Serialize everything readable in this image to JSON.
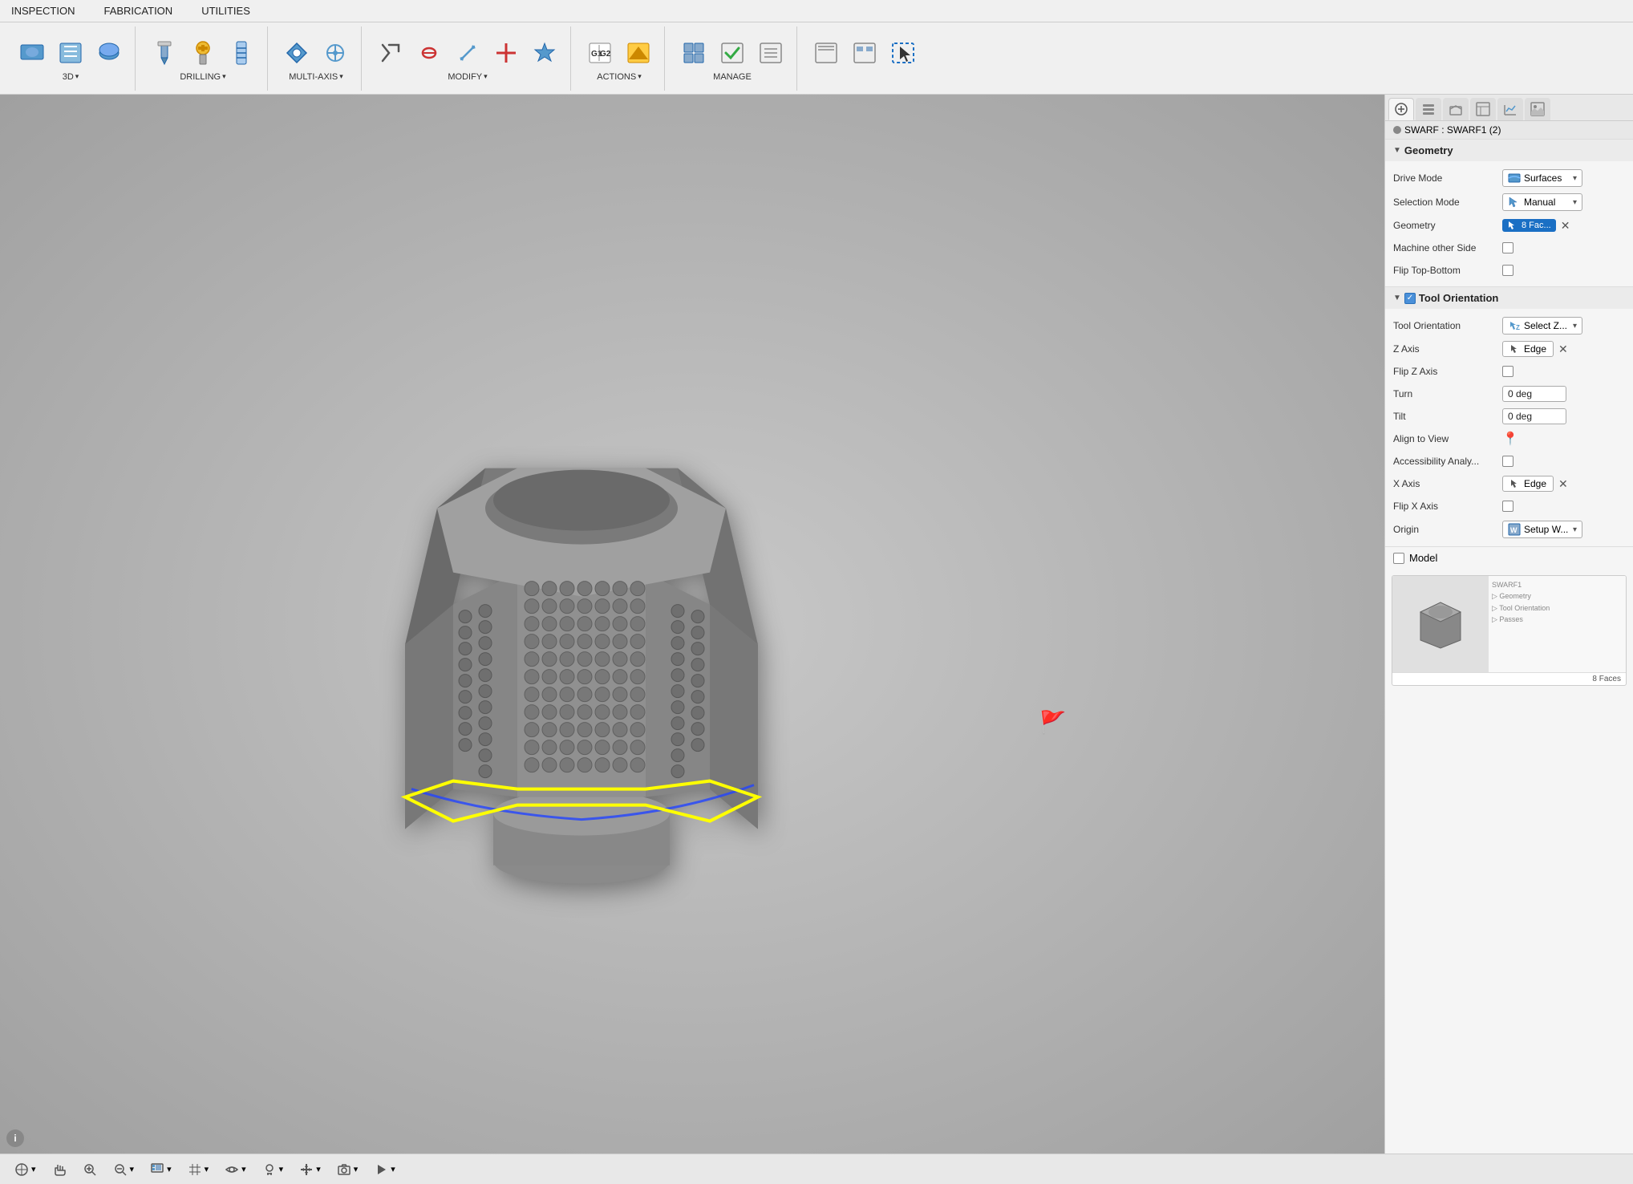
{
  "menu": {
    "items": [
      "INSPECTION",
      "FABRICATION",
      "UTILITIES"
    ]
  },
  "toolbar": {
    "groups": [
      {
        "label": "3D",
        "hasArrow": true,
        "icons": [
          "3d-turning-icon",
          "3d-milling-icon",
          "3d-pocket-icon"
        ]
      },
      {
        "label": "DRILLING",
        "hasArrow": true,
        "icons": [
          "drill-icon",
          "drill2-icon",
          "drill3-icon"
        ]
      },
      {
        "label": "MULTI-AXIS",
        "hasArrow": true,
        "icons": [
          "multiaxis-icon",
          "multiaxis2-icon"
        ]
      },
      {
        "label": "MODIFY",
        "hasArrow": true,
        "icons": [
          "modify-scissors-icon",
          "modify-chain-icon",
          "modify-arrow-icon",
          "modify-cross-icon",
          "modify-star-icon"
        ]
      },
      {
        "label": "ACTIONS",
        "hasArrow": true,
        "icons": [
          "g1g2-icon",
          "actions2-icon"
        ]
      },
      {
        "label": "MANAGE",
        "icons": [
          "manage1-icon",
          "manage2-icon",
          "manage3-icon"
        ]
      },
      {
        "label": "",
        "icons": [
          "nav1-icon",
          "nav2-icon",
          "select-icon"
        ]
      }
    ]
  },
  "panel": {
    "swarf_title": "SWARF : SWARF1 (2)",
    "tabs": [
      "wrench-icon",
      "layers-icon",
      "box-icon",
      "table-icon",
      "chart-icon",
      "image-icon"
    ],
    "geometry_section": {
      "label": "Geometry",
      "expanded": true,
      "drive_mode": {
        "label": "Drive Mode",
        "value": "Surfaces",
        "icon": "surfaces-icon"
      },
      "selection_mode": {
        "label": "Selection Mode",
        "value": "Manual",
        "icon": "manual-icon"
      },
      "geometry": {
        "label": "Geometry",
        "value": "8 Fac...",
        "icon": "cursor-icon"
      },
      "machine_other_side": {
        "label": "Machine other Side",
        "checked": false
      },
      "flip_top_bottom": {
        "label": "Flip Top-Bottom",
        "checked": false
      }
    },
    "tool_orientation_section": {
      "label": "Tool Orientation",
      "expanded": true,
      "enabled": true,
      "tool_orientation": {
        "label": "Tool Orientation",
        "value": "Select Z...",
        "icon": "select-z-icon"
      },
      "z_axis": {
        "label": "Z Axis",
        "value": "Edge"
      },
      "flip_z_axis": {
        "label": "Flip Z Axis",
        "checked": false
      },
      "turn": {
        "label": "Turn",
        "value": "0 deg"
      },
      "tilt": {
        "label": "Tilt",
        "value": "0 deg"
      },
      "align_to_view": {
        "label": "Align to View",
        "icon": "pin-icon"
      },
      "accessibility_analysis": {
        "label": "Accessibility Analy...",
        "checked": false
      },
      "x_axis": {
        "label": "X Axis",
        "value": "Edge"
      },
      "flip_x_axis": {
        "label": "Flip X Axis",
        "checked": false
      },
      "origin": {
        "label": "Origin",
        "value": "Setup W...",
        "icon": "setup-w-icon"
      }
    },
    "model_section": {
      "label": "Model",
      "checked": false
    }
  },
  "statusbar": {
    "items": [
      "coordinate-icon",
      "hand-icon",
      "zoom-icon",
      "zoom2-icon",
      "display-icon",
      "grid-icon",
      "view-icon",
      "light-icon",
      "move-icon",
      "camera-icon",
      "play-icon"
    ]
  }
}
